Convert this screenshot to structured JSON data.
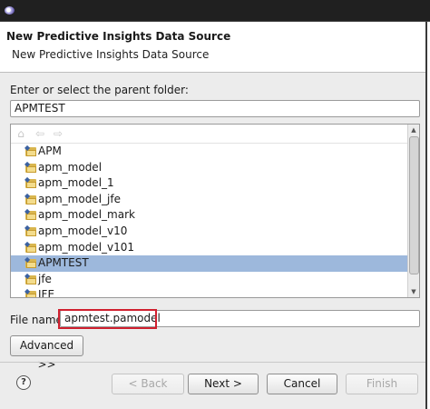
{
  "window": {
    "icon": "eclipse-icon"
  },
  "wizard": {
    "title": "New Predictive Insights Data Source",
    "description": "New Predictive Insights Data Source"
  },
  "parent_folder": {
    "label": "Enter or select the parent folder:",
    "value": "APMTEST"
  },
  "tree": {
    "toolbar_icons": [
      "home-icon",
      "back-arrow-icon",
      "forward-arrow-icon"
    ],
    "items": [
      {
        "label": "APM"
      },
      {
        "label": "apm_model"
      },
      {
        "label": "apm_model_1"
      },
      {
        "label": "apm_model_jfe"
      },
      {
        "label": "apm_model_mark"
      },
      {
        "label": "apm_model_v10"
      },
      {
        "label": "apm_model_v101"
      },
      {
        "label": "APMTEST",
        "selected": true
      },
      {
        "label": "jfe"
      },
      {
        "label": "JFE"
      }
    ]
  },
  "file_name": {
    "label": "File name:",
    "value": "apmtest.pamodel"
  },
  "buttons": {
    "advanced": "Advanced >>",
    "back": "< Back",
    "next": "Next >",
    "cancel": "Cancel",
    "finish": "Finish",
    "help": "?"
  }
}
